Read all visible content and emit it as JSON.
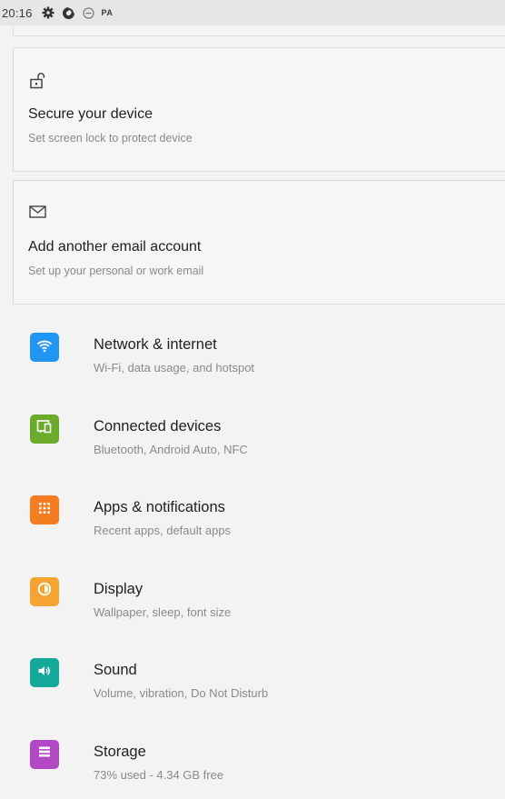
{
  "status_bar": {
    "time": "20:16",
    "icons": [
      "gear-icon",
      "data-saver-icon",
      "do-not-disturb-icon"
    ],
    "pa_label": "PA"
  },
  "suggestions": [
    {
      "icon": "lock-open-icon",
      "title": "Secure your device",
      "subtitle": "Set screen lock to protect device"
    },
    {
      "icon": "mail-icon",
      "title": "Add another email account",
      "subtitle": "Set up your personal or work email"
    }
  ],
  "settings": [
    {
      "icon": "wifi-icon",
      "color": "#2196f3",
      "title": "Network & internet",
      "subtitle": "Wi-Fi, data usage, and hotspot"
    },
    {
      "icon": "connected-devices-icon",
      "color": "#6aac2a",
      "title": "Connected devices",
      "subtitle": "Bluetooth, Android Auto, NFC"
    },
    {
      "icon": "apps-grid-icon",
      "color": "#f57c1f",
      "title": "Apps & notifications",
      "subtitle": "Recent apps, default apps"
    },
    {
      "icon": "brightness-icon",
      "color": "#f6a431",
      "title": "Display",
      "subtitle": "Wallpaper, sleep, font size"
    },
    {
      "icon": "volume-icon",
      "color": "#15a99b",
      "title": "Sound",
      "subtitle": "Volume, vibration, Do Not Disturb"
    },
    {
      "icon": "storage-icon",
      "color": "#b248c6",
      "title": "Storage",
      "subtitle": "73% used - 4.34 GB free"
    }
  ]
}
